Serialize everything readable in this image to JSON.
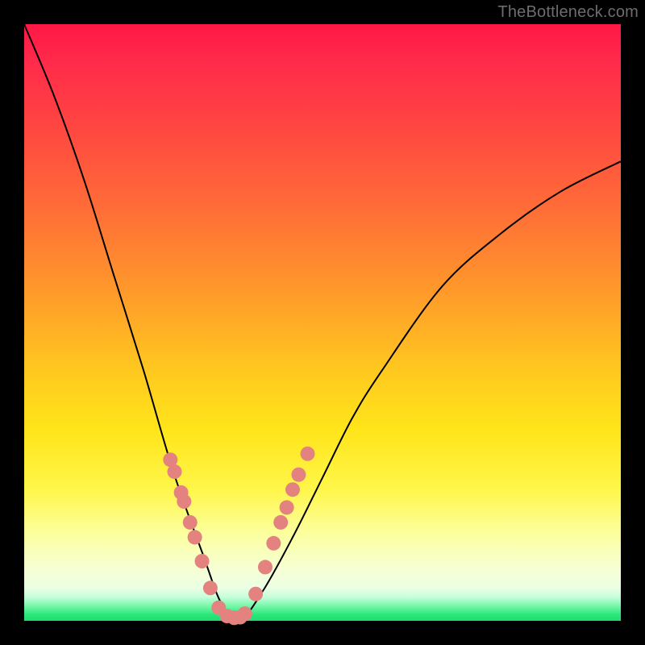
{
  "watermark": "TheBottleneck.com",
  "chart_data": {
    "type": "line",
    "title": "",
    "xlabel": "",
    "ylabel": "",
    "xlim": [
      0,
      1
    ],
    "ylim": [
      0,
      100
    ],
    "series": [
      {
        "name": "bottleneck-curve",
        "x": [
          0.0,
          0.05,
          0.1,
          0.15,
          0.2,
          0.25,
          0.3,
          0.33,
          0.36,
          0.4,
          0.45,
          0.5,
          0.55,
          0.6,
          0.7,
          0.8,
          0.9,
          1.0
        ],
        "y": [
          100,
          88,
          74,
          58,
          42,
          25,
          11,
          3,
          0,
          5,
          14,
          24,
          34,
          42,
          56,
          65,
          72,
          77
        ]
      }
    ],
    "markers": {
      "name": "highlight-dots",
      "x": [
        0.245,
        0.252,
        0.263,
        0.268,
        0.278,
        0.286,
        0.298,
        0.312,
        0.326,
        0.34,
        0.352,
        0.362,
        0.37,
        0.388,
        0.404,
        0.418,
        0.43,
        0.44,
        0.45,
        0.46,
        0.475
      ],
      "y": [
        27,
        25,
        21.5,
        20,
        16.5,
        14,
        10,
        5.5,
        2.2,
        0.8,
        0.5,
        0.6,
        1.2,
        4.5,
        9,
        13,
        16.5,
        19,
        22,
        24.5,
        28
      ]
    },
    "background_gradient": {
      "stops": [
        {
          "pos": 0.0,
          "color": "#ff1744"
        },
        {
          "pos": 0.3,
          "color": "#ff6a38"
        },
        {
          "pos": 0.6,
          "color": "#ffe51a"
        },
        {
          "pos": 0.9,
          "color": "#f5ffd8"
        },
        {
          "pos": 1.0,
          "color": "#1fdc6f"
        }
      ]
    }
  }
}
